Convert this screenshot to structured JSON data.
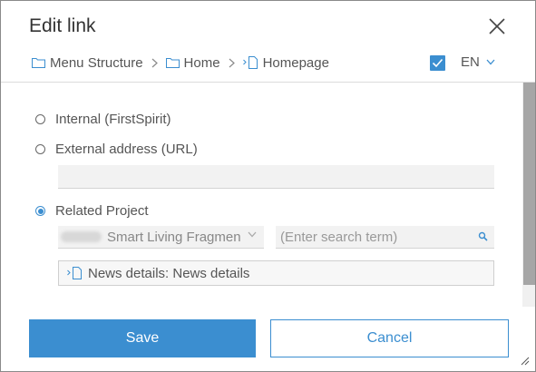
{
  "dialog": {
    "title": "Edit link",
    "breadcrumb": [
      {
        "label": "Menu Structure",
        "icon": "folder-icon"
      },
      {
        "label": "Home",
        "icon": "folder-icon"
      },
      {
        "label": "Homepage",
        "icon": "page-icon"
      }
    ],
    "language": "EN",
    "language_checked": true
  },
  "options": {
    "internal": "Internal (FirstSpirit)",
    "external": "External address (URL)",
    "related": "Related Project",
    "selected": "related"
  },
  "external_url": {
    "value": ""
  },
  "related": {
    "project": "Smart Living Fragmen",
    "search_placeholder": "(Enter search term)",
    "target": "News details: News details"
  },
  "buttons": {
    "save": "Save",
    "cancel": "Cancel"
  },
  "colors": {
    "accent": "#3b8ed0"
  }
}
